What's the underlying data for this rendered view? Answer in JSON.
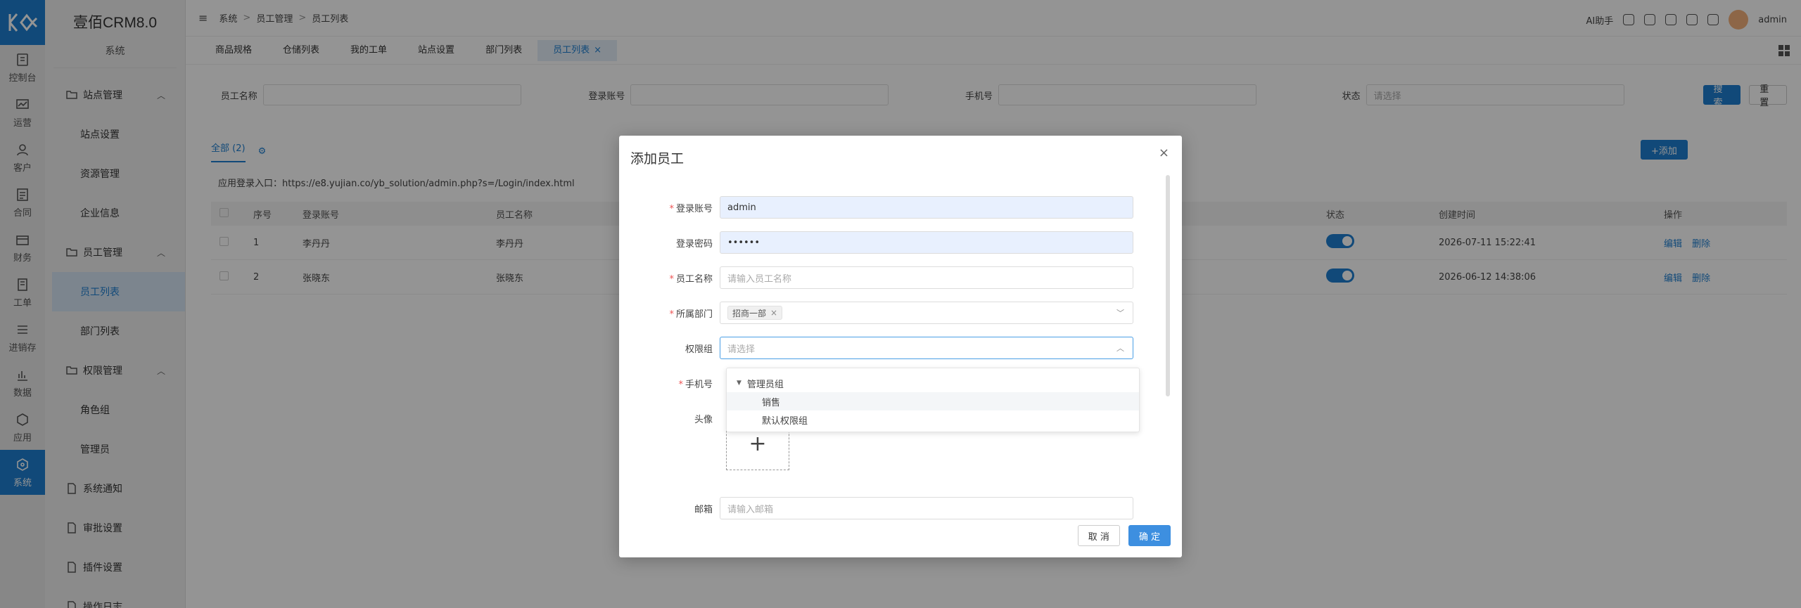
{
  "app": {
    "brand": "壹佰CRM8.0",
    "section": "系统"
  },
  "rail": [
    {
      "label": "控制台",
      "icon": "dashboard-icon"
    },
    {
      "label": "运营",
      "icon": "chart-icon"
    },
    {
      "label": "客户",
      "icon": "customer-icon"
    },
    {
      "label": "合同",
      "icon": "contract-icon"
    },
    {
      "label": "财务",
      "icon": "finance-icon"
    },
    {
      "label": "工单",
      "icon": "ticket-icon"
    },
    {
      "label": "进销存",
      "icon": "inventory-icon"
    },
    {
      "label": "数据",
      "icon": "data-icon"
    },
    {
      "label": "应用",
      "icon": "app-icon"
    },
    {
      "label": "系统",
      "icon": "system-icon"
    }
  ],
  "sidebar": {
    "groups": [
      {
        "label": "站点管理",
        "items": [
          "站点设置",
          "资源管理",
          "企业信息"
        ]
      },
      {
        "label": "员工管理",
        "items": [
          "员工列表",
          "部门列表"
        ]
      },
      {
        "label": "权限管理",
        "items": [
          "角色组",
          "管理员"
        ]
      }
    ],
    "singles": [
      "系统通知",
      "审批设置",
      "插件设置",
      "操作日志"
    ]
  },
  "breadcrumb": [
    "系统",
    "员工管理",
    "员工列表"
  ],
  "topright": {
    "ai": "AI助手",
    "user": "admin"
  },
  "tabs": [
    "商品规格",
    "仓储列表",
    "我的工单",
    "站点设置",
    "部门列表",
    "员工列表"
  ],
  "filters": {
    "name_label": "员工名称",
    "account_label": "登录账号",
    "phone_label": "手机号",
    "status_label": "状态",
    "status_placeholder": "请选择",
    "search_btn": "搜索",
    "reset_btn": "重置"
  },
  "list": {
    "tab_all": "全部 (2)",
    "add_btn": "+添加",
    "login_entry": "应用登录入口：https://e8.yujian.co/yb_solution/admin.php?s=/Login/index.html",
    "headers": {
      "no": "序号",
      "account": "登录账号",
      "name": "员工名称",
      "status": "状态",
      "created": "创建时间",
      "ops": "操作"
    },
    "rows": [
      {
        "no": "1",
        "account": "李丹丹",
        "name": "李丹丹",
        "created": "2026-07-11 15:22:41",
        "edit": "编辑",
        "delete": "删除"
      },
      {
        "no": "2",
        "account": "张晓东",
        "name": "张晓东",
        "created": "2026-06-12 14:38:06",
        "edit": "编辑",
        "delete": "删除"
      }
    ]
  },
  "modal": {
    "title": "添加员工",
    "fields": {
      "account": {
        "label": "登录账号",
        "value": "admin"
      },
      "password": {
        "label": "登录密码",
        "value": "••••••"
      },
      "name": {
        "label": "员工名称",
        "placeholder": "请输入员工名称"
      },
      "dept": {
        "label": "所属部门",
        "tag": "招商一部"
      },
      "role": {
        "label": "权限组",
        "placeholder": "请选择"
      },
      "phone": {
        "label": "手机号"
      },
      "avatar": {
        "label": "头像"
      },
      "email": {
        "label": "邮箱",
        "placeholder": "请输入邮箱"
      }
    },
    "dropdown": {
      "parent": "管理员组",
      "children": [
        "销售",
        "默认权限组"
      ]
    },
    "cancel": "取 消",
    "ok": "确 定"
  }
}
